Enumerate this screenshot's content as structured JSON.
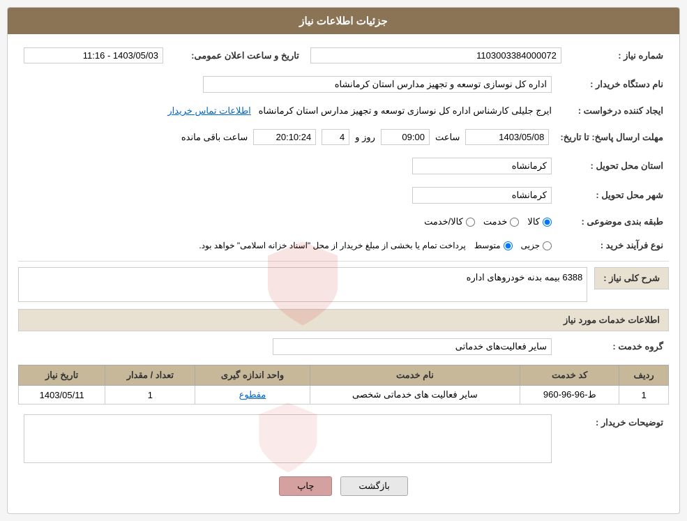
{
  "header": {
    "title": "جزئیات اطلاعات نیاز"
  },
  "fields": {
    "need_number_label": "شماره نیاز :",
    "need_number_value": "1103003384000072",
    "buyer_org_label": "نام دستگاه خریدار :",
    "buyer_org_value": "اداره کل نوسازی  توسعه و تجهیز مدارس استان کرمانشاه",
    "requester_label": "ایجاد کننده درخواست :",
    "requester_value": "ایرج جلیلی کارشناس اداره کل نوسازی  توسعه و تجهیز مدارس استان کرمانشاه",
    "contact_link": "اطلاعات تماس خریدار",
    "deadline_label": "مهلت ارسال پاسخ: تا تاریخ:",
    "deadline_date": "1403/05/08",
    "deadline_time_label": "ساعت",
    "deadline_time": "09:00",
    "deadline_days_label": "روز و",
    "deadline_days": "4",
    "deadline_remaining_label": "ساعت باقی مانده",
    "deadline_remaining": "20:10:24",
    "province_label": "استان محل تحویل :",
    "province_value": "کرمانشاه",
    "city_label": "شهر محل تحویل :",
    "city_value": "کرمانشاه",
    "category_label": "طبقه بندی موضوعی :",
    "announcement_date_label": "تاریخ و ساعت اعلان عمومی:",
    "announcement_date_value": "1403/05/03 - 11:16",
    "category_options": [
      {
        "label": "کالا",
        "value": "kala",
        "selected": true
      },
      {
        "label": "خدمت",
        "value": "khedmat",
        "selected": false
      },
      {
        "label": "کالا/خدمت",
        "value": "kala_khedmat",
        "selected": false
      }
    ],
    "process_label": "نوع فرآیند خرید :",
    "process_options": [
      {
        "label": "جزیی",
        "value": "jozi",
        "selected": false
      },
      {
        "label": "متوسط",
        "value": "motavaset",
        "selected": true
      }
    ],
    "process_desc": "پرداخت تمام یا بخشی از مبلغ خریدار از محل \"اسناد خزانه اسلامی\" خواهد بود.",
    "general_desc_label": "شرح کلی نیاز :",
    "general_desc_value": "6388 بیمه بدنه خودروهای اداره",
    "services_section_label": "اطلاعات خدمات مورد نیاز",
    "service_group_label": "گروه خدمت :",
    "service_group_value": "سایر فعالیت‌های خدماتی",
    "table_headers": [
      "ردیف",
      "کد خدمت",
      "نام خدمت",
      "واحد اندازه گیری",
      "تعداد / مقدار",
      "تاریخ نیاز"
    ],
    "table_rows": [
      {
        "row": "1",
        "code": "ط-96-96-960",
        "name": "سایر فعالیت های خدماتی شخصی",
        "unit": "مقطوع",
        "quantity": "1",
        "date": "1403/05/11"
      }
    ],
    "buyer_desc_label": "توضیحات خریدار :",
    "buyer_desc_value": ""
  },
  "buttons": {
    "print_label": "چاپ",
    "back_label": "بازگشت"
  }
}
